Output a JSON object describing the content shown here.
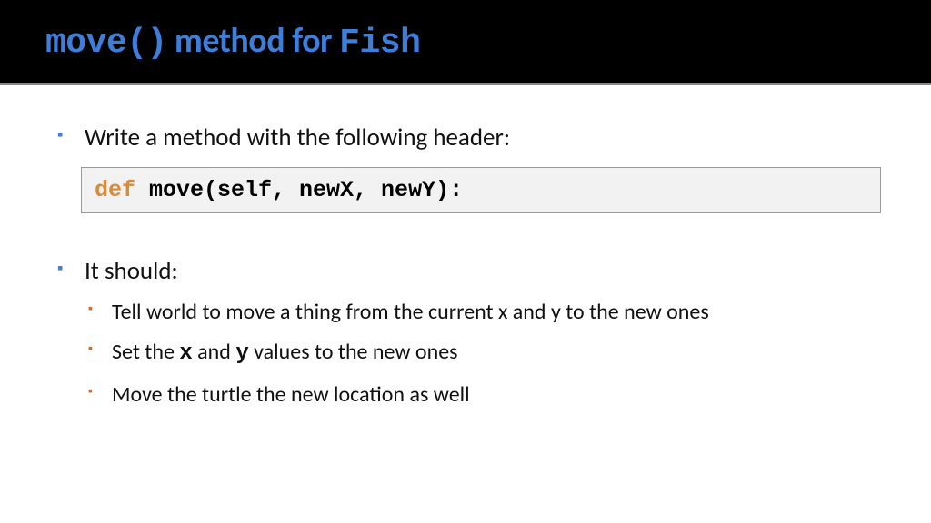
{
  "title": {
    "code1": "move()",
    "middle": " method for ",
    "code2": "Fish"
  },
  "bullets": [
    {
      "text": "Write a method with the following header:"
    },
    {
      "text": "It should:",
      "sub": [
        "Tell world to move a thing from the current x and y to the new ones",
        "Set the x and y values to the new ones",
        "Move the turtle the new location as well"
      ],
      "sub_parts": {
        "pre": "Set the ",
        "x": "x",
        "and": " and ",
        "y": "y",
        "post": " values to the new ones"
      }
    }
  ],
  "code": {
    "keyword": "def",
    "body": " move(self, newX, newY):"
  }
}
